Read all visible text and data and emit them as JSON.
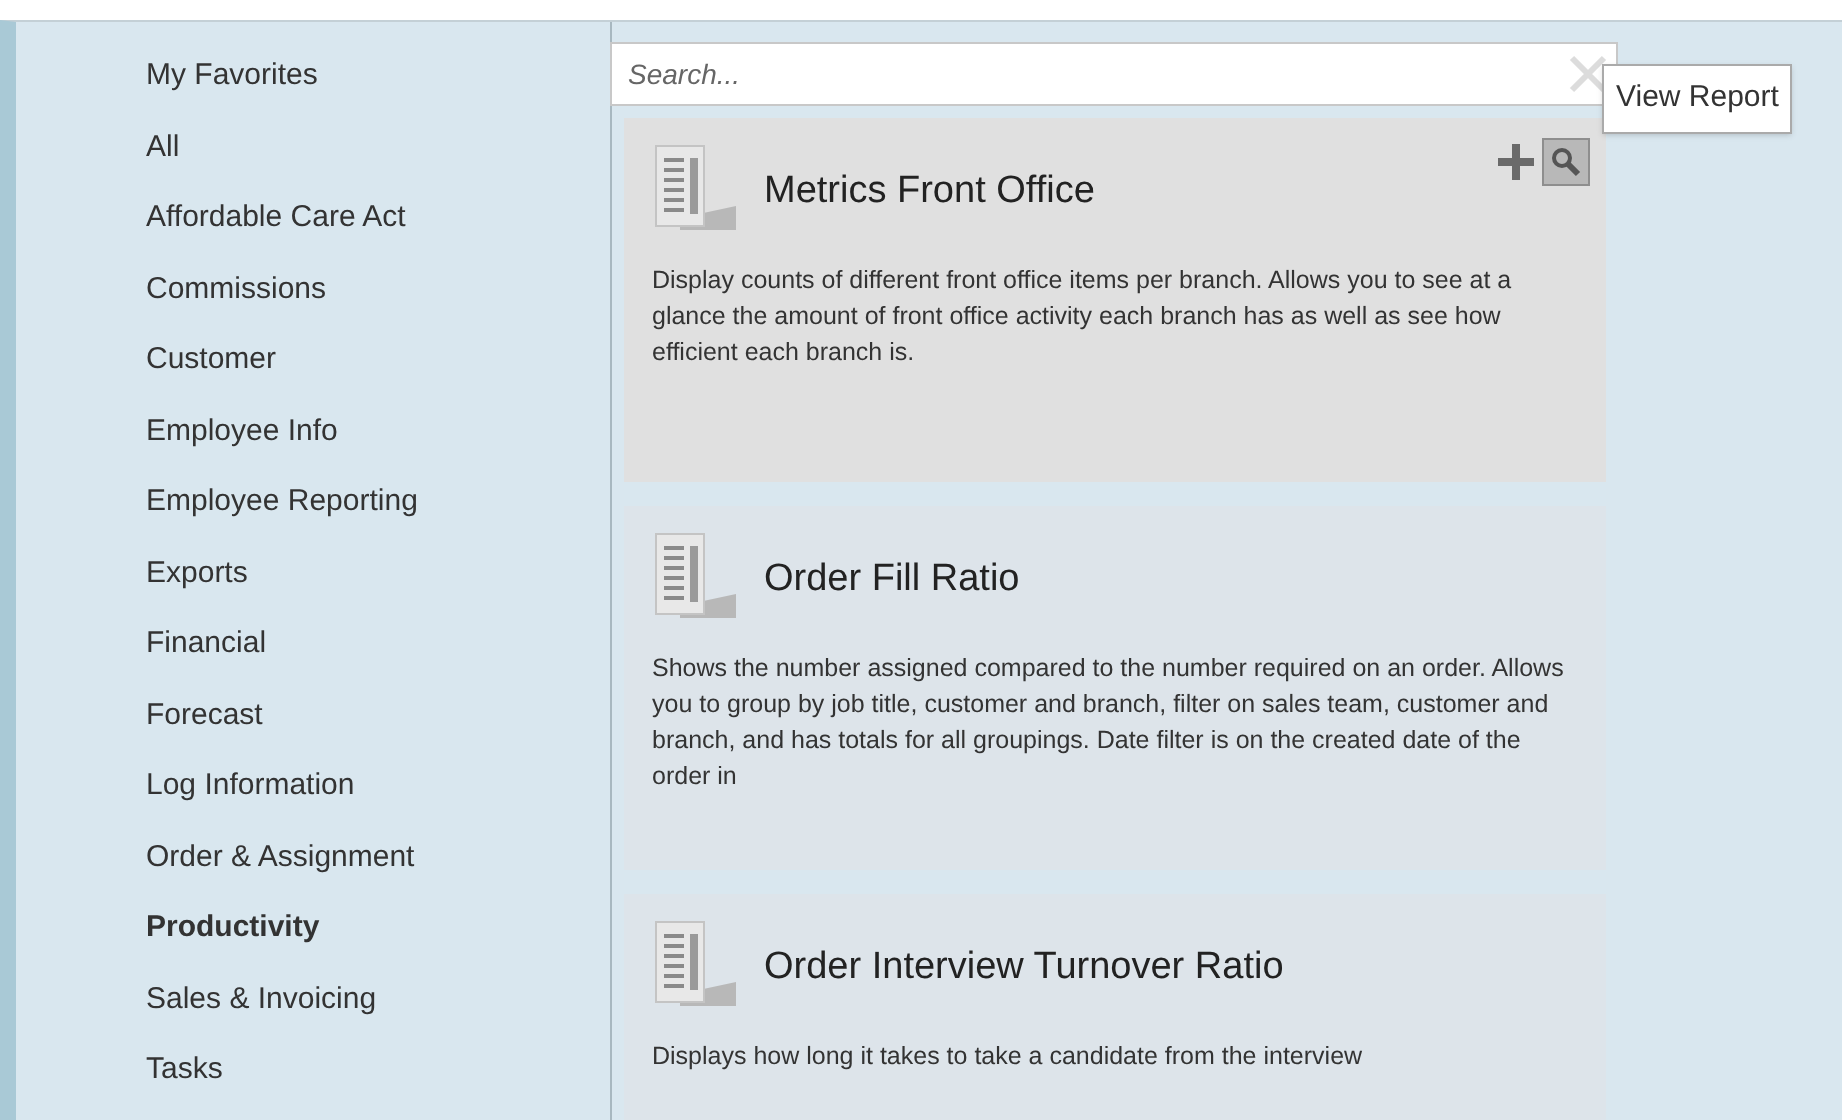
{
  "sidebar": {
    "items": [
      {
        "label": "My Favorites",
        "selected": false
      },
      {
        "label": "All",
        "selected": false
      },
      {
        "label": "Affordable Care Act",
        "selected": false
      },
      {
        "label": "Commissions",
        "selected": false
      },
      {
        "label": "Customer",
        "selected": false
      },
      {
        "label": "Employee Info",
        "selected": false
      },
      {
        "label": "Employee Reporting",
        "selected": false
      },
      {
        "label": "Exports",
        "selected": false
      },
      {
        "label": "Financial",
        "selected": false
      },
      {
        "label": "Forecast",
        "selected": false
      },
      {
        "label": "Log Information",
        "selected": false
      },
      {
        "label": "Order & Assignment",
        "selected": false
      },
      {
        "label": "Productivity",
        "selected": true
      },
      {
        "label": "Sales & Invoicing",
        "selected": false
      },
      {
        "label": "Tasks",
        "selected": false
      }
    ]
  },
  "search": {
    "placeholder": "Search..."
  },
  "reports": [
    {
      "title": "Metrics Front Office",
      "description": "Display counts of different front office items per branch.  Allows you to see at a glance the amount of front office activity each branch has as well as see how efficient each branch is.",
      "highlighted": true
    },
    {
      "title": "Order Fill Ratio",
      "description": "Shows the number assigned compared to the number required on an order.  Allows you to group by job title, customer and branch, filter on sales team, customer and branch, and has totals for all groupings. Date filter is on the created date of the order in",
      "highlighted": false
    },
    {
      "title": "Order Interview Turnover Ratio",
      "description": "Displays how long it takes to take a candidate from the interview",
      "highlighted": false
    }
  ],
  "tooltip": {
    "text": "View Report"
  }
}
